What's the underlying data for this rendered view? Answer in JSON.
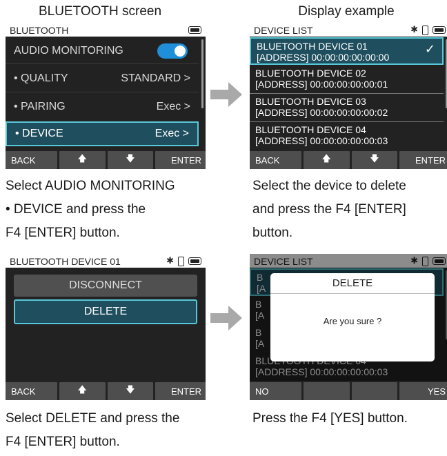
{
  "captions": {
    "top_left": "BLUETOOTH screen",
    "top_right": "Display example",
    "step1": [
      "Select AUDIO MONITORING",
      "• DEVICE and press the",
      "F4 [ENTER] button."
    ],
    "step2": [
      "Select the device to delete",
      "and press the F4 [ENTER]",
      "button."
    ],
    "step3": [
      "Select DELETE and press the",
      "F4 [ENTER] button."
    ],
    "step4": [
      "Press the F4 [YES] button."
    ]
  },
  "screen1": {
    "title": "BLUETOOTH",
    "rows": [
      {
        "label": "AUDIO MONITORING",
        "value": "",
        "toggle_on": true
      },
      {
        "label": "• QUALITY",
        "value": "STANDARD >"
      },
      {
        "label": "• PAIRING",
        "value": "Exec >"
      },
      {
        "label": "• DEVICE",
        "value": "Exec >",
        "selected": true
      }
    ],
    "keys": [
      "BACK",
      "🡅",
      "🡇",
      "ENTER"
    ]
  },
  "screen2": {
    "title": "DEVICE LIST",
    "devices": [
      {
        "name": "BLUETOOTH DEVICE 01",
        "address": "[ADDRESS] 00:00:00:00:00:00",
        "selected": true
      },
      {
        "name": "BLUETOOTH DEVICE 02",
        "address": "[ADDRESS] 00:00:00:00:00:01"
      },
      {
        "name": "BLUETOOTH DEVICE 03",
        "address": "[ADDRESS] 00:00:00:00:00:02"
      },
      {
        "name": "BLUETOOTH DEVICE 04",
        "address": "[ADDRESS] 00:00:00:00:00:03"
      }
    ],
    "check": "✓",
    "keys": [
      "BACK",
      "🡅",
      "🡇",
      "ENTER"
    ]
  },
  "screen3": {
    "title": "BLUETOOTH DEVICE 01",
    "disconnect": "DISCONNECT",
    "delete": "DELETE",
    "keys": [
      "BACK",
      "🡅",
      "🡇",
      "ENTER"
    ]
  },
  "screen4": {
    "title": "DEVICE LIST",
    "bg_rows": [
      {
        "name": "B",
        "address": "[A"
      },
      {
        "name": "B",
        "address": "[A"
      },
      {
        "name": "B",
        "address": "[A"
      },
      {
        "name": "BLUETOOTH DEVICE 04",
        "address": "[ADDRESS] 00:00:00:00:00:03"
      }
    ],
    "dialog_title": "DELETE",
    "dialog_message": "Are you sure ?",
    "keys": [
      "NO",
      "",
      "",
      "YES"
    ]
  },
  "icons": {
    "bluetooth": "bluetooth-icon",
    "phone": "phone-icon",
    "battery": "battery-icon",
    "arrow": "right-arrow-icon"
  },
  "colors": {
    "selection_fill": "#1f4f5e",
    "selection_border": "#58c8d8",
    "toggle_on": "#1e8fd8",
    "screen_bg": "#222222",
    "key_bg": "#4e4e4e",
    "arrow_gray": "#a9a9a9"
  }
}
